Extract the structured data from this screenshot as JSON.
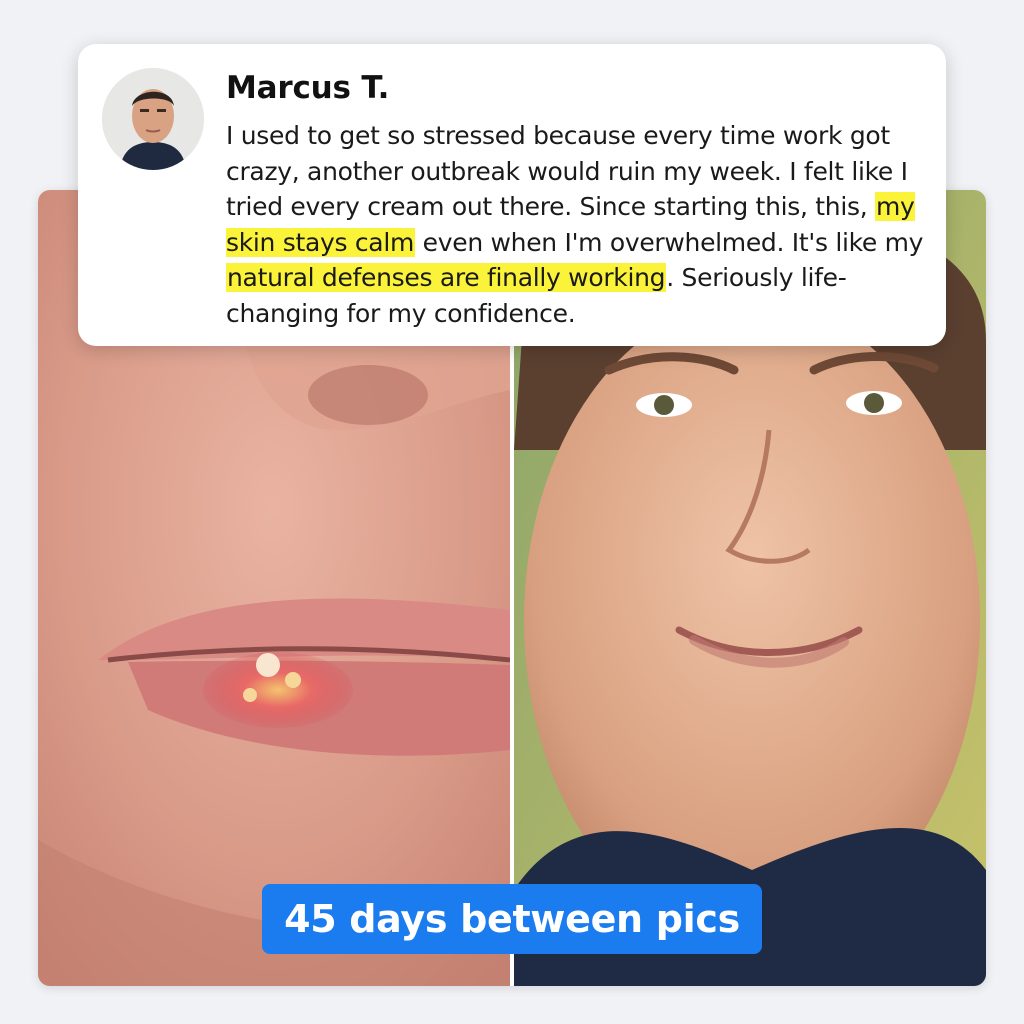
{
  "review": {
    "name": "Marcus T.",
    "text_parts": [
      {
        "text": "I used to get so stressed because every time work got crazy, another outbreak would ruin my week. I felt like I tried every cream out there. Since starting this, this, ",
        "highlight": false
      },
      {
        "text": "my skin stays calm",
        "highlight": true
      },
      {
        "text": " even when I'm overwhelmed. It's like my ",
        "highlight": false
      },
      {
        "text": "natural defenses are finally working",
        "highlight": true
      },
      {
        "text": ". Seriously life-changing for my confidence.",
        "highlight": false
      }
    ]
  },
  "photos": {
    "before": "before-photo-cold-sore-lip",
    "after": "after-photo-smiling-man"
  },
  "caption": {
    "label": "45 days between pics"
  },
  "colors": {
    "highlight": "#fbf33a",
    "badge": "#1b7cf0",
    "background": "#f1f2f6"
  }
}
